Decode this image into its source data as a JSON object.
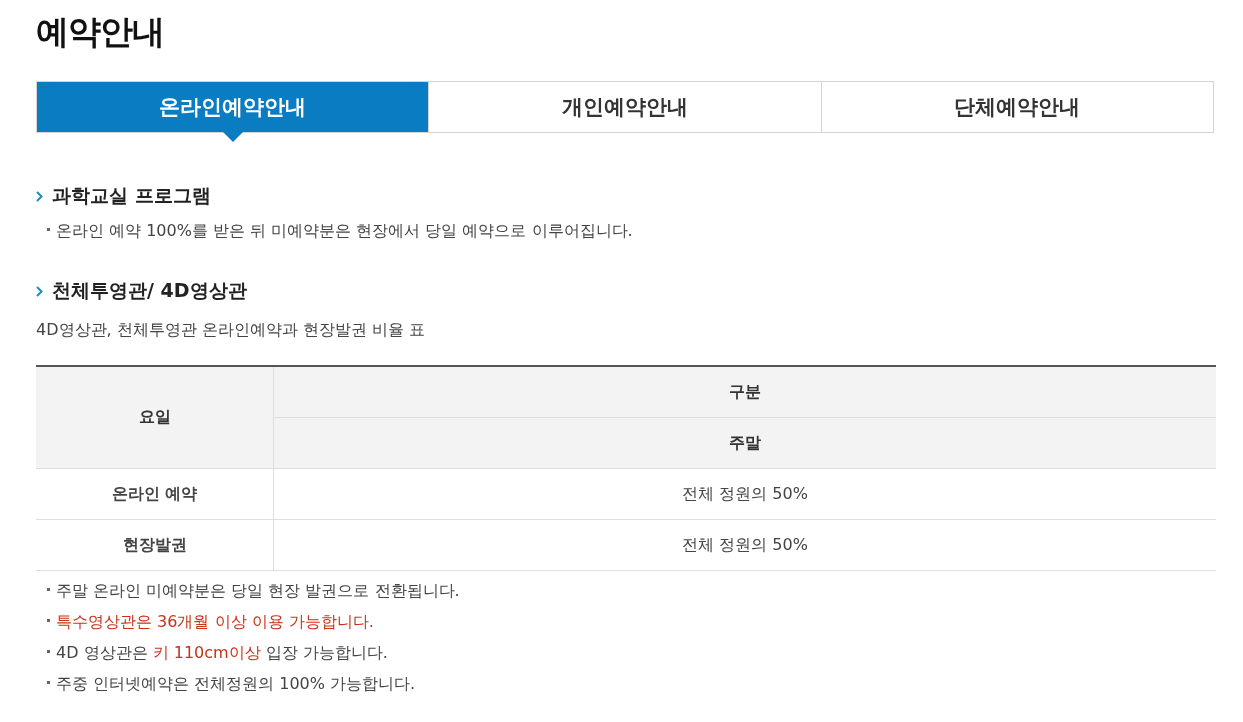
{
  "page_title": "예약안내",
  "tabs": [
    {
      "label": "온라인예약안내",
      "selected": true
    },
    {
      "label": "개인예약안내",
      "selected": false
    },
    {
      "label": "단체예약안내",
      "selected": false
    }
  ],
  "sections": [
    {
      "heading": "과학교실 프로그램",
      "bullets": [
        "온라인 예약 100%를 받은 뒤 미예약분은 현장에서 당일 예약으로 이루어집니다."
      ]
    },
    {
      "heading": "천체투영관/ 4D영상관",
      "caption": "4D영상관, 천체투영관 온라인예약과 현장발권 비율 표"
    }
  ],
  "table": {
    "header_day": "요일",
    "header_group": "구분",
    "header_sub": "주말",
    "rows": [
      {
        "label": "온라인 예약",
        "value": "전체 정원의 50%"
      },
      {
        "label": "현장발권",
        "value": "전체 정원의 50%"
      }
    ]
  },
  "notes": [
    [
      {
        "text": "주말 온라인 미예약분은 당일 현장 발권으로 전환됩니다.",
        "highlight": false
      }
    ],
    [
      {
        "text": "특수영상관은 36개월 이상 이용 가능합니다.",
        "highlight": true
      }
    ],
    [
      {
        "text": "4D 영상관은 ",
        "highlight": false
      },
      {
        "text": "키 110cm이상",
        "highlight": true
      },
      {
        "text": " 입장 가능합니다.",
        "highlight": false
      }
    ],
    [
      {
        "text": "주중 인터넷예약은 전체정원의 100% 가능합니다.",
        "highlight": false
      }
    ]
  ]
}
